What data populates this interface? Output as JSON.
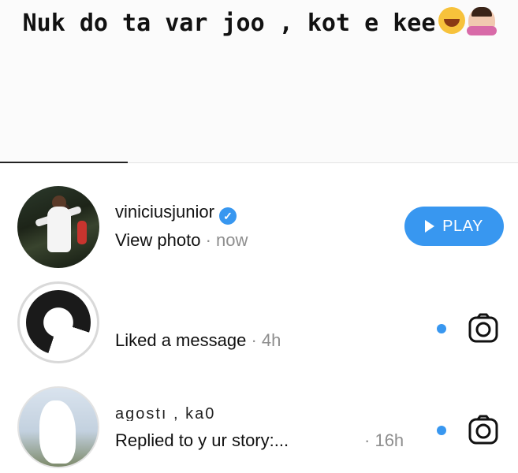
{
  "story": {
    "caption": "Nuk do ta var joo , kot e kee",
    "caption_emojis": [
      "face-with-tears-of-joy",
      "person-shrugging"
    ]
  },
  "messages": [
    {
      "username": "viniciusjunior",
      "verified": true,
      "subtitle": "View photo",
      "separator": "·",
      "time": "now",
      "action_label": "PLAY"
    },
    {
      "username": "",
      "subtitle": "Liked a message",
      "separator": "·",
      "time": "4h",
      "unread": true,
      "action_icon": "camera-icon"
    },
    {
      "username": "agostı , ka0",
      "subtitle": "Replied to y ur story:...",
      "separator": "·",
      "time": "16h",
      "unread": true,
      "action_icon": "camera-icon"
    }
  ],
  "colors": {
    "accent": "#3897f0",
    "secondary_text": "#8e8e8e",
    "primary_text": "#111111"
  }
}
